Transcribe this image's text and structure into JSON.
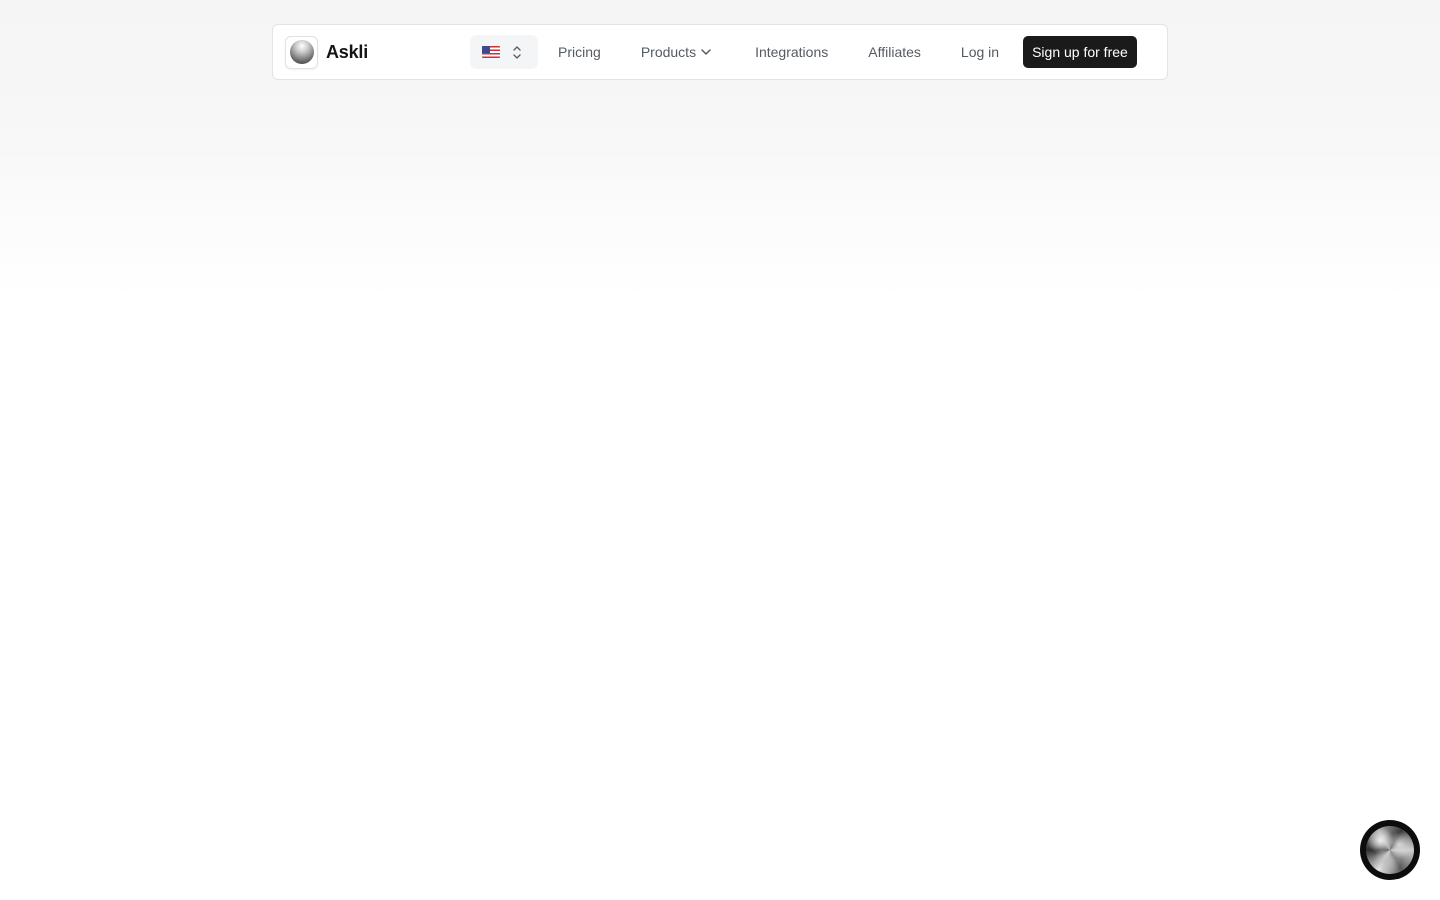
{
  "header": {
    "brand": {
      "name": "Askli",
      "logo_icon": "sphere-logo-icon"
    },
    "language_selector": {
      "selected": "🇺🇸",
      "flag_icon": "us-flag-icon",
      "toggle_icon": "chevron-up-down-icon"
    },
    "nav": {
      "pricing": "Pricing",
      "products": "Products",
      "products_icon": "chevron-down-icon",
      "integrations": "Integrations",
      "affiliates": "Affiliates",
      "login": "Log in",
      "signup": "Sign up for free"
    }
  },
  "chat_widget": {
    "icon": "chat-orb-icon"
  },
  "colors": {
    "signup_bg": "#1a1a1a",
    "nav_text": "#555b63",
    "brand_text": "#141414",
    "page_bg_top": "#f5f5f5",
    "page_bg_bottom": "#ffffff"
  }
}
